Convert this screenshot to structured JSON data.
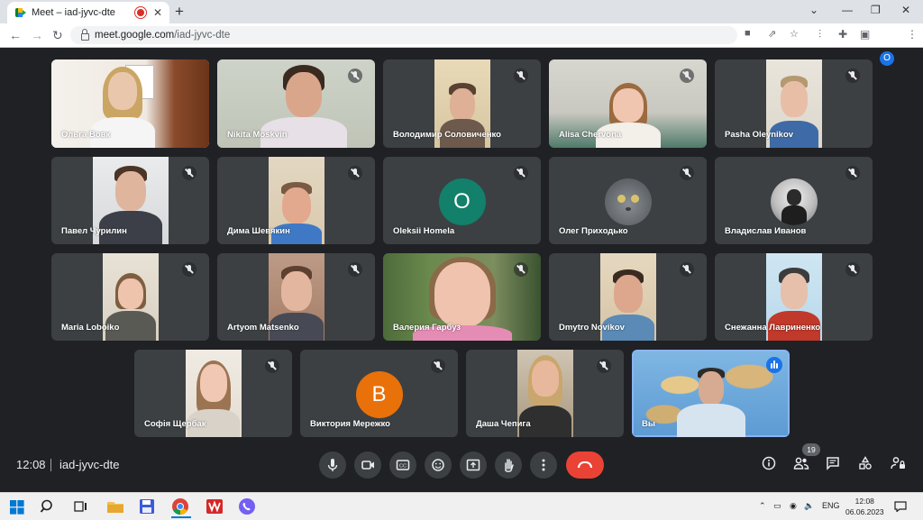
{
  "browser": {
    "tab_title": "Meet – iad-jyvc-dte",
    "url_host": "meet.google.com",
    "url_path": "/iad-jyvc-dte",
    "profile_initial": "O",
    "icons": [
      "back-icon",
      "forward-icon",
      "reload-icon",
      "lock-icon",
      "camera-icon",
      "share-icon",
      "star-icon",
      "pin-icon",
      "extensions-icon",
      "sidepanel-icon",
      "menu-icon"
    ]
  },
  "participants": [
    {
      "name": "Ольга Вовк",
      "muted": false
    },
    {
      "name": "Nikita Moskvin",
      "muted": true
    },
    {
      "name": "Володимир Соловиченко",
      "muted": true
    },
    {
      "name": "Alisa Chervona",
      "muted": true
    },
    {
      "name": "Pasha Oleynikov",
      "muted": true
    },
    {
      "name": "Павел Чурилин",
      "muted": true
    },
    {
      "name": "Дима Шевякин",
      "muted": true
    },
    {
      "name": "Oleksii Homela",
      "muted": true,
      "avatar_letter": "O",
      "avatar_color": "#12806a"
    },
    {
      "name": "Олег Приходько",
      "muted": true
    },
    {
      "name": "Владислав Иванов",
      "muted": true
    },
    {
      "name": "Maria Loboiko",
      "muted": true
    },
    {
      "name": "Artyom Matsenko",
      "muted": true
    },
    {
      "name": "Валерия Гарбуз",
      "muted": true
    },
    {
      "name": "Dmytro Novikov",
      "muted": true
    },
    {
      "name": "Снежанна Лавриненко",
      "muted": true
    },
    {
      "name": "Софія Щербак",
      "muted": true
    },
    {
      "name": "Виктория Мережко",
      "muted": true,
      "avatar_letter": "В",
      "avatar_color": "#e8710a"
    },
    {
      "name": "Даша Чепига",
      "muted": true
    },
    {
      "name": "Вы",
      "muted": false,
      "speaking": true
    }
  ],
  "meeting": {
    "time": "12:08",
    "code": "iad-jyvc-dte",
    "participant_count": "19",
    "end_color": "#ea4335"
  },
  "taskbar": {
    "lang": "ENG",
    "time": "12:08",
    "date": "06.06.2023"
  }
}
